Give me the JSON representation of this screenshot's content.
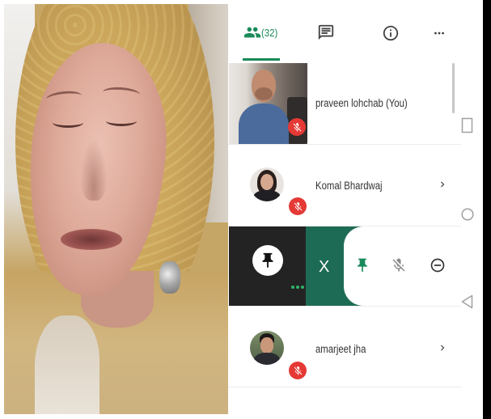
{
  "colors": {
    "accent_green": "#1a8a5a",
    "swipe_green": "#1e6b55",
    "mute_red": "#e53935",
    "icon_dark": "#424242",
    "icon_gray": "#8a8a8a",
    "nav_gray": "#a0a0a0",
    "text": "#333333"
  },
  "tabs": {
    "people": {
      "icon": "people-icon",
      "count": "(32)",
      "selected": true
    },
    "chat": {
      "icon": "chat-icon",
      "selected": false
    },
    "info": {
      "icon": "info-icon",
      "selected": false
    },
    "more": {
      "icon": "more-horiz-icon",
      "selected": false
    }
  },
  "participants": [
    {
      "name": "praveen lohchab (You)",
      "muted": true,
      "status_icon": "mic-off-icon",
      "trailing_icon": null
    },
    {
      "name": "Komal Bhardwaj",
      "muted": true,
      "status_icon": "mic-off-icon",
      "trailing_icon": "chevron-right-icon"
    },
    {
      "name": "amarjeet jha",
      "muted": true,
      "status_icon": "mic-off-icon",
      "trailing_icon": "chevron-right-icon"
    }
  ],
  "swiped_participant": {
    "avatar_icon": "pin-icon",
    "indicator_icon": "speaking-indicator-icon",
    "close_label": "X",
    "actions": [
      {
        "icon": "pin-icon",
        "highlighted": true
      },
      {
        "icon": "mic-off-icon",
        "highlighted": false
      },
      {
        "icon": "remove-circle-icon",
        "highlighted": false
      }
    ]
  },
  "system_nav": [
    {
      "icon": "recents-square-icon"
    },
    {
      "icon": "home-circle-icon"
    },
    {
      "icon": "back-triangle-icon"
    }
  ]
}
